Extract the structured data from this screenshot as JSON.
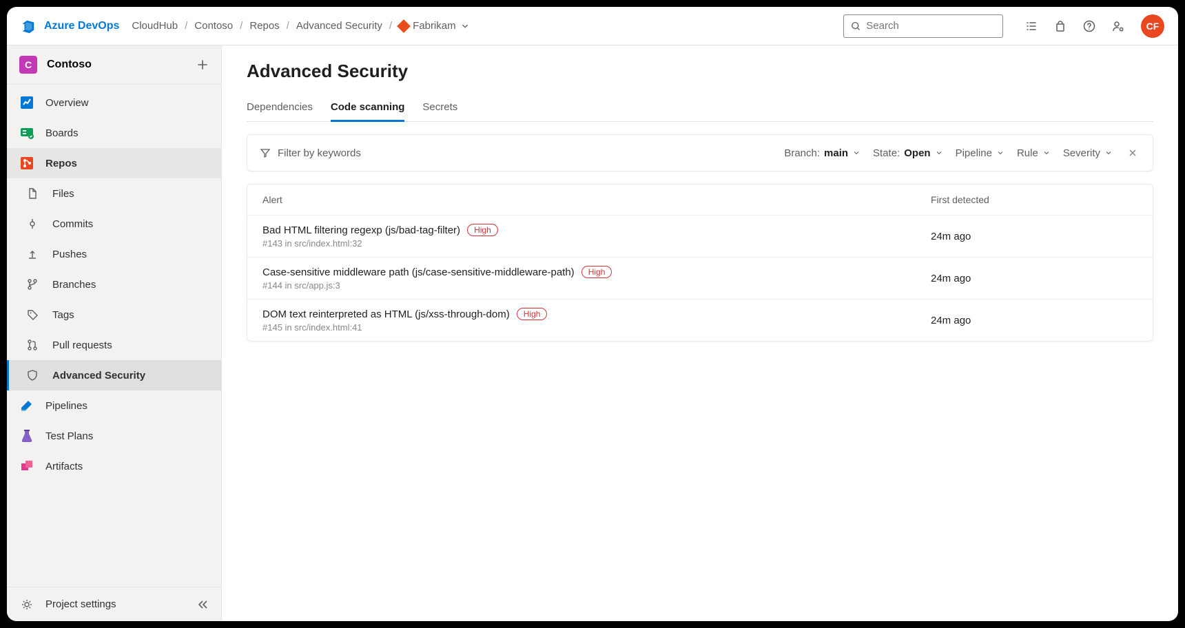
{
  "brand": "Azure DevOps",
  "breadcrumbs": {
    "org": "CloudHub",
    "project": "Contoso",
    "section": "Repos",
    "page": "Advanced Security",
    "repo": "Fabrikam"
  },
  "search": {
    "placeholder": "Search"
  },
  "avatar": "CF",
  "project": {
    "initial": "C",
    "name": "Contoso"
  },
  "sidebar": {
    "items": [
      {
        "label": "Overview"
      },
      {
        "label": "Boards"
      },
      {
        "label": "Repos"
      },
      {
        "label": "Files"
      },
      {
        "label": "Commits"
      },
      {
        "label": "Pushes"
      },
      {
        "label": "Branches"
      },
      {
        "label": "Tags"
      },
      {
        "label": "Pull requests"
      },
      {
        "label": "Advanced Security"
      },
      {
        "label": "Pipelines"
      },
      {
        "label": "Test Plans"
      },
      {
        "label": "Artifacts"
      }
    ],
    "settings": "Project settings"
  },
  "page_title": "Advanced Security",
  "tabs": [
    {
      "label": "Dependencies"
    },
    {
      "label": "Code scanning"
    },
    {
      "label": "Secrets"
    }
  ],
  "filters": {
    "placeholder": "Filter by keywords",
    "branch_label": "Branch:",
    "branch_value": "main",
    "state_label": "State:",
    "state_value": "Open",
    "pipeline_label": "Pipeline",
    "rule_label": "Rule",
    "severity_label": "Severity"
  },
  "table": {
    "col_alert": "Alert",
    "col_detected": "First detected",
    "rows": [
      {
        "title": "Bad HTML filtering regexp (js/bad-tag-filter)",
        "severity": "High",
        "sub": "#143 in src/index.html:32",
        "detected": "24m ago"
      },
      {
        "title": "Case-sensitive middleware path (js/case-sensitive-middleware-path)",
        "severity": "High",
        "sub": "#144 in src/app.js:3",
        "detected": "24m ago"
      },
      {
        "title": "DOM text reinterpreted as HTML (js/xss-through-dom)",
        "severity": "High",
        "sub": "#145 in src/index.html:41",
        "detected": "24m ago"
      }
    ]
  }
}
